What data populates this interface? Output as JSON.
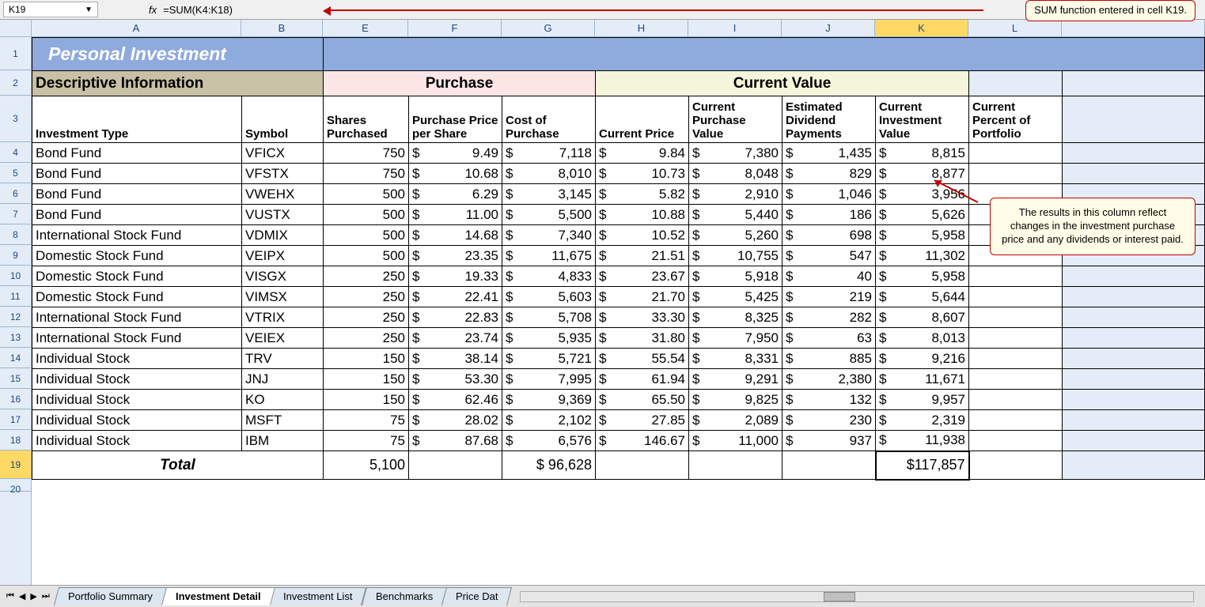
{
  "formula_bar": {
    "name_box": "K19",
    "fx_label": "fx",
    "formula": "=SUM(K4:K18)"
  },
  "annotations": {
    "top": "SUM function entered in cell K19.",
    "side": "The results in this column reflect changes in the investment purchase price and any dividends or interest paid."
  },
  "columns": [
    "A",
    "B",
    "E",
    "F",
    "G",
    "H",
    "I",
    "J",
    "K",
    "L"
  ],
  "active_column": "K",
  "title": "Personal Investment",
  "sections": {
    "descriptive": "Descriptive Information",
    "purchase": "Purchase",
    "current": "Current Value"
  },
  "headers": {
    "investment_type": "Investment Type",
    "symbol": "Symbol",
    "shares": "Shares Purchased",
    "price_per_share": "Purchase Price per Share",
    "cost": "Cost of Purchase",
    "cur_price": "Current Price",
    "cur_purchase_value": "Current Purchase Value",
    "dividend": "Estimated Dividend Payments",
    "cur_inv_value": "Current Investment Value",
    "percent": "Current Percent of Portfolio"
  },
  "rows": [
    {
      "type": "Bond Fund",
      "sym": "VFICX",
      "shares": "750",
      "pps": "9.49",
      "cost": "7,118",
      "price": "9.84",
      "pval": "7,380",
      "div": "1,435",
      "ival": "8,815"
    },
    {
      "type": "Bond Fund",
      "sym": "VFSTX",
      "shares": "750",
      "pps": "10.68",
      "cost": "8,010",
      "price": "10.73",
      "pval": "8,048",
      "div": "829",
      "ival": "8,877"
    },
    {
      "type": "Bond Fund",
      "sym": "VWEHX",
      "shares": "500",
      "pps": "6.29",
      "cost": "3,145",
      "price": "5.82",
      "pval": "2,910",
      "div": "1,046",
      "ival": "3,956"
    },
    {
      "type": "Bond Fund",
      "sym": "VUSTX",
      "shares": "500",
      "pps": "11.00",
      "cost": "5,500",
      "price": "10.88",
      "pval": "5,440",
      "div": "186",
      "ival": "5,626"
    },
    {
      "type": "International Stock Fund",
      "sym": "VDMIX",
      "shares": "500",
      "pps": "14.68",
      "cost": "7,340",
      "price": "10.52",
      "pval": "5,260",
      "div": "698",
      "ival": "5,958"
    },
    {
      "type": "Domestic Stock Fund",
      "sym": "VEIPX",
      "shares": "500",
      "pps": "23.35",
      "cost": "11,675",
      "price": "21.51",
      "pval": "10,755",
      "div": "547",
      "ival": "11,302"
    },
    {
      "type": "Domestic Stock Fund",
      "sym": "VISGX",
      "shares": "250",
      "pps": "19.33",
      "cost": "4,833",
      "price": "23.67",
      "pval": "5,918",
      "div": "40",
      "ival": "5,958"
    },
    {
      "type": "Domestic Stock Fund",
      "sym": "VIMSX",
      "shares": "250",
      "pps": "22.41",
      "cost": "5,603",
      "price": "21.70",
      "pval": "5,425",
      "div": "219",
      "ival": "5,644"
    },
    {
      "type": "International Stock Fund",
      "sym": "VTRIX",
      "shares": "250",
      "pps": "22.83",
      "cost": "5,708",
      "price": "33.30",
      "pval": "8,325",
      "div": "282",
      "ival": "8,607"
    },
    {
      "type": "International Stock Fund",
      "sym": "VEIEX",
      "shares": "250",
      "pps": "23.74",
      "cost": "5,935",
      "price": "31.80",
      "pval": "7,950",
      "div": "63",
      "ival": "8,013"
    },
    {
      "type": "Individual Stock",
      "sym": "TRV",
      "shares": "150",
      "pps": "38.14",
      "cost": "5,721",
      "price": "55.54",
      "pval": "8,331",
      "div": "885",
      "ival": "9,216"
    },
    {
      "type": "Individual Stock",
      "sym": "JNJ",
      "shares": "150",
      "pps": "53.30",
      "cost": "7,995",
      "price": "61.94",
      "pval": "9,291",
      "div": "2,380",
      "ival": "11,671"
    },
    {
      "type": "Individual Stock",
      "sym": "KO",
      "shares": "150",
      "pps": "62.46",
      "cost": "9,369",
      "price": "65.50",
      "pval": "9,825",
      "div": "132",
      "ival": "9,957"
    },
    {
      "type": "Individual Stock",
      "sym": "MSFT",
      "shares": "75",
      "pps": "28.02",
      "cost": "2,102",
      "price": "27.85",
      "pval": "2,089",
      "div": "230",
      "ival": "2,319"
    },
    {
      "type": "Individual Stock",
      "sym": "IBM",
      "shares": "75",
      "pps": "87.68",
      "cost": "6,576",
      "price": "146.67",
      "pval": "11,000",
      "div": "937",
      "ival": "11,938"
    }
  ],
  "totals": {
    "label": "Total",
    "shares": "5,100",
    "cost": "$ 96,628",
    "ival": "$117,857"
  },
  "tabs": {
    "items": [
      "Portfolio Summary",
      "Investment Detail",
      "Investment List",
      "Benchmarks",
      "Price Dat"
    ],
    "active": "Investment Detail"
  },
  "col_widths": {
    "A": 265,
    "B": 103,
    "E": 108,
    "F": 118,
    "G": 118,
    "H": 118,
    "I": 118,
    "J": 118,
    "K": 118,
    "L": 118,
    "rest": 163
  }
}
